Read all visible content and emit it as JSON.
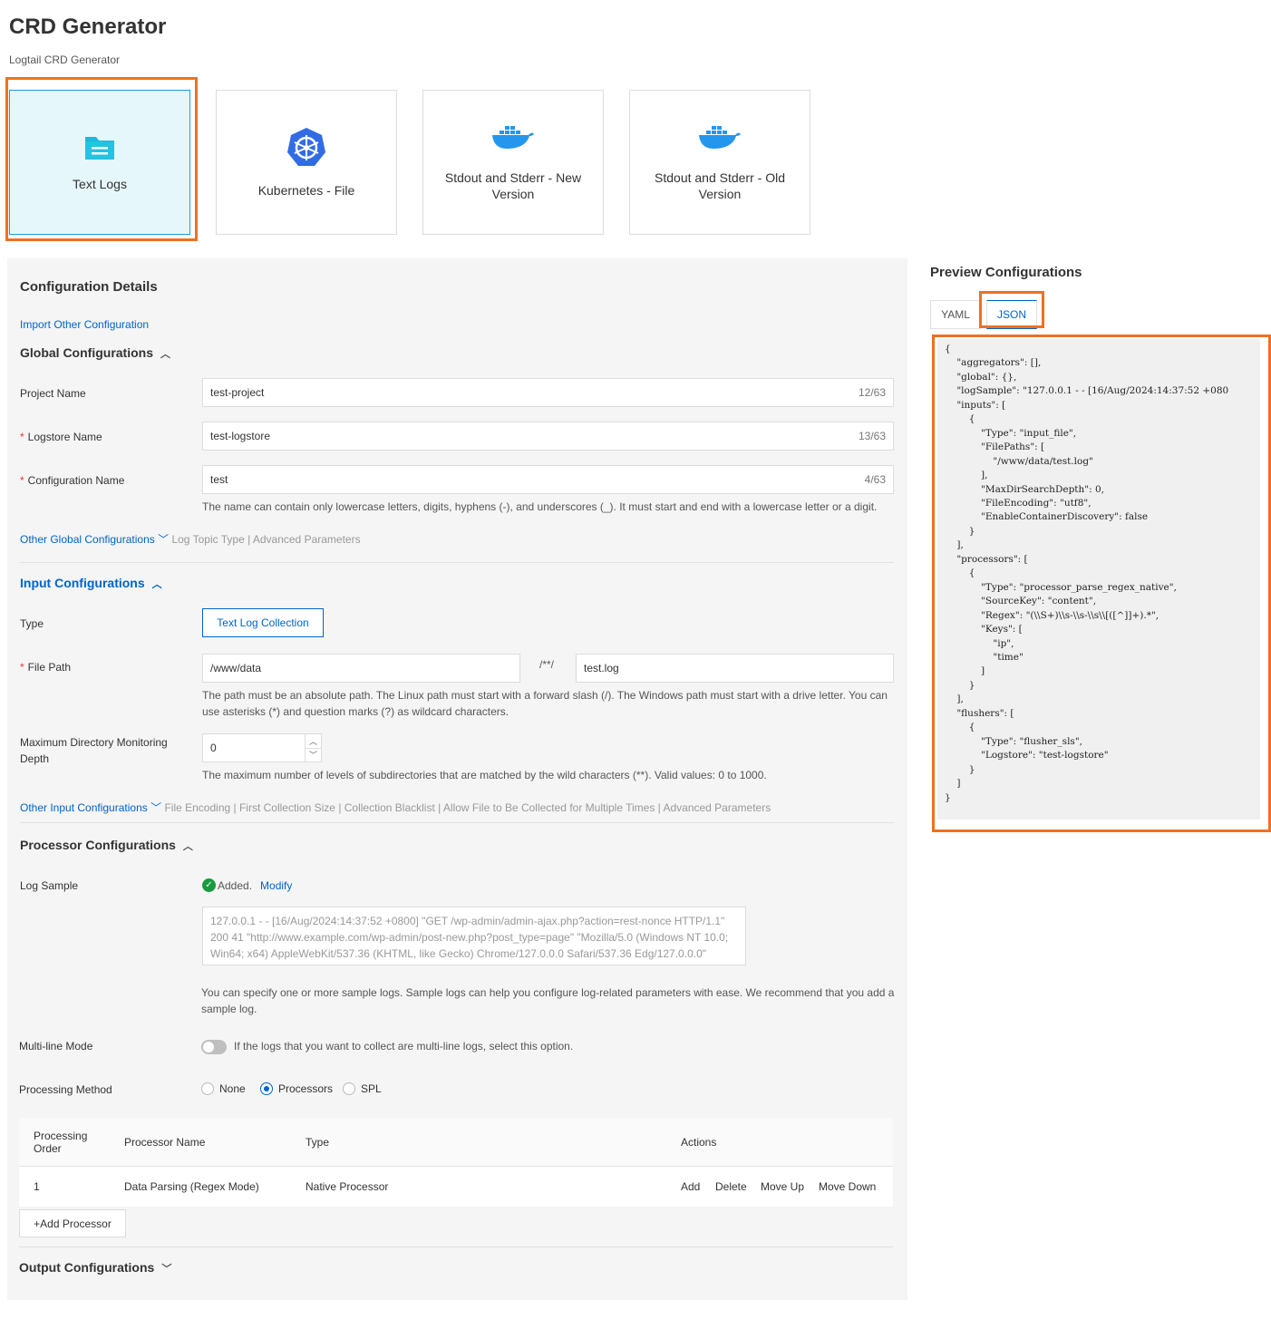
{
  "header": {
    "title": "CRD Generator",
    "subtitle": "Logtail CRD Generator"
  },
  "cards": [
    {
      "label": "Text Logs",
      "icon": "folder-icon",
      "selected": true
    },
    {
      "label": "Kubernetes - File",
      "icon": "kubernetes-icon",
      "selected": false
    },
    {
      "label": "Stdout and Stderr - New Version",
      "icon": "docker-icon",
      "selected": false
    },
    {
      "label": "Stdout and Stderr - Old Version",
      "icon": "docker-icon",
      "selected": false
    }
  ],
  "config": {
    "title": "Configuration Details",
    "import_link": "Import Other Configuration",
    "global": {
      "title": "Global Configurations",
      "project_label": "Project Name",
      "project_value": "test-project",
      "project_count": "12/63",
      "logstore_label": "Logstore Name",
      "logstore_value": "test-logstore",
      "logstore_count": "13/63",
      "config_label": "Configuration Name",
      "config_value": "test",
      "config_count": "4/63",
      "config_hint": "The name can contain only lowercase letters, digits, hyphens (-), and underscores (_). It must start and end with a lowercase letter or a digit.",
      "other_link": "Other Global Configurations",
      "other_items": "Log Topic Type | Advanced Parameters"
    },
    "input": {
      "title": "Input Configurations",
      "type_label": "Type",
      "type_button": "Text Log Collection",
      "path_label": "File Path",
      "path_dir": "/www/data",
      "path_sep": "/**/",
      "path_file": "test.log",
      "path_hint_1": "The path must be an absolute path. The Linux path must start with a forward slash (/). The Windows path must start with a drive letter. You can",
      "path_hint_2": "use asterisks (*) and question marks (?) as wildcard characters.",
      "depth_label_1": "Maximum Directory Monitoring",
      "depth_label_2": "Depth",
      "depth_value": "0",
      "depth_hint": "The maximum number of levels of subdirectories that are matched by the wild characters (**). Valid values: 0 to 1000.",
      "other_link": "Other Input Configurations",
      "other_items": "File Encoding | First Collection Size | Collection Blacklist | Allow File to Be Collected for Multiple Times | Advanced Parameters"
    },
    "processor": {
      "title": "Processor Configurations",
      "sample_label": "Log Sample",
      "sample_added": "Added.",
      "sample_modify": "Modify",
      "sample_text_1": "127.0.0.1 - - [16/Aug/2024:14:37:52 +0800] \"GET /wp-admin/admin-ajax.php?action=rest-nonce HTTP/1.1\"",
      "sample_text_2": "200 41 \"http://www.example.com/wp-admin/post-new.php?post_type=page\" \"Mozilla/5.0 (Windows NT 10.0;",
      "sample_text_3": "Win64; x64) AppleWebKit/537.36 (KHTML, like Gecko) Chrome/127.0.0.0 Safari/537.36 Edg/127.0.0.0\"",
      "sample_hint_1": "You can specify one or more sample logs. Sample logs can help you configure log-related parameters with ease. We recommend that you add a",
      "sample_hint_2": "sample log.",
      "multiline_label": "Multi-line Mode",
      "multiline_hint": "If the logs that you want to collect are multi-line logs, select this option.",
      "method_label": "Processing Method",
      "method_options": [
        "None",
        "Processors",
        "SPL"
      ],
      "method_selected": "Processors",
      "table_headers": {
        "order_1": "Processing",
        "order_2": "Order",
        "name": "Processor Name",
        "type": "Type",
        "actions": "Actions"
      },
      "rows": [
        {
          "order": "1",
          "name": "Data Parsing (Regex Mode)",
          "type": "Native Processor",
          "add": "Add",
          "delete": "Delete",
          "up": "Move Up",
          "down": "Move Down"
        }
      ],
      "add_button": "+Add Processor"
    },
    "output": {
      "title": "Output Configurations"
    }
  },
  "preview": {
    "title": "Preview Configurations",
    "tabs": [
      "YAML",
      "JSON"
    ],
    "active_tab": "JSON",
    "code": "{\n    \"aggregators\": [],\n    \"global\": {},\n    \"logSample\": \"127.0.0.1 - - [16/Aug/2024:14:37:52 +080\n    \"inputs\": [\n        {\n            \"Type\": \"input_file\",\n            \"FilePaths\": [\n                \"/www/data/test.log\"\n            ],\n            \"MaxDirSearchDepth\": 0,\n            \"FileEncoding\": \"utf8\",\n            \"EnableContainerDiscovery\": false\n        }\n    ],\n    \"processors\": [\n        {\n            \"Type\": \"processor_parse_regex_native\",\n            \"SourceKey\": \"content\",\n            \"Regex\": \"(\\\\S+)\\\\s-\\\\s-\\\\s\\\\[([^]]+).*\",\n            \"Keys\": [\n                \"ip\",\n                \"time\"\n            ]\n        }\n    ],\n    \"flushers\": [\n        {\n            \"Type\": \"flusher_sls\",\n            \"Logstore\": \"test-logstore\"\n        }\n    ]\n}"
  },
  "colors": {
    "highlight": "#f07020",
    "accent": "#0064c8",
    "selected_card_bg": "#e6f7fc"
  }
}
